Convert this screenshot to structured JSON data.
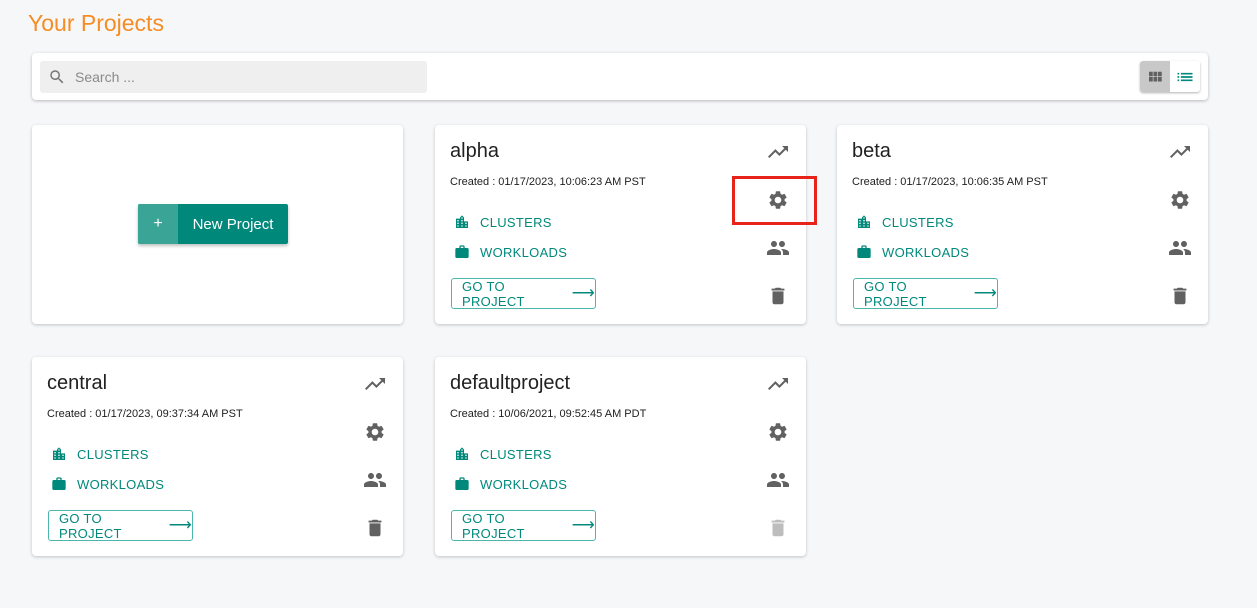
{
  "page": {
    "title": "Your Projects"
  },
  "toolbar": {
    "search_placeholder": "Search ...",
    "search_value": "",
    "view_grid_label": "grid-view",
    "view_list_label": "list-view",
    "active_view": "grid"
  },
  "new_project": {
    "plus": "+",
    "label": "New Project"
  },
  "projects": [
    {
      "name": "alpha",
      "created": "Created : 01/17/2023, 10:06:23 AM PST",
      "clusters_label": "CLUSTERS",
      "workloads_label": "WORKLOADS",
      "goto_label": "GO TO PROJECT",
      "delete_enabled": true
    },
    {
      "name": "beta",
      "created": "Created : 01/17/2023, 10:06:35 AM PST",
      "clusters_label": "CLUSTERS",
      "workloads_label": "WORKLOADS",
      "goto_label": "GO TO PROJECT",
      "delete_enabled": true
    },
    {
      "name": "central",
      "created": "Created : 01/17/2023, 09:37:34 AM PST",
      "clusters_label": "CLUSTERS",
      "workloads_label": "WORKLOADS",
      "goto_label": "GO TO PROJECT",
      "delete_enabled": true
    },
    {
      "name": "defaultproject",
      "created": "Created : 10/06/2021, 09:52:45 AM PDT",
      "clusters_label": "CLUSTERS",
      "workloads_label": "WORKLOADS",
      "goto_label": "GO TO PROJECT",
      "delete_enabled": false
    }
  ],
  "colors": {
    "title": "#f58c25",
    "accent": "#00897b",
    "icon": "#616161",
    "icon_disabled": "#bdbdbd",
    "highlight": "#e8231a"
  },
  "annotation": {
    "highlighted_element": "alpha settings (gear) icon"
  }
}
